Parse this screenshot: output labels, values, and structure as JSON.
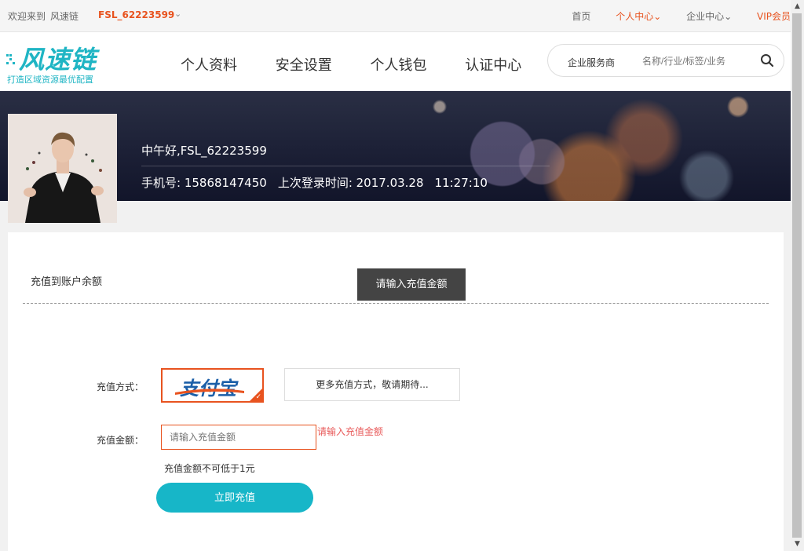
{
  "topbar": {
    "welcome": "欢迎来到",
    "site_name": "风速链",
    "username": "FSL_62223599",
    "links": [
      {
        "label": "首页"
      },
      {
        "label": "个人中心⌄"
      },
      {
        "label": "企业中心⌄"
      },
      {
        "label": "VIP会员"
      }
    ]
  },
  "logo": {
    "text": "风速链",
    "slogan": "打造区域资源最优配置"
  },
  "nav": [
    "个人资料",
    "安全设置",
    "个人钱包",
    "认证中心"
  ],
  "search": {
    "category": "企业服务商",
    "placeholder": "名称/行业/标签/业务"
  },
  "profile": {
    "greeting": "中午好,FSL_62223599",
    "phone": "手机号: 15868147450",
    "last_login": "上次登录时间: 2017.03.28",
    "last_login_time": "11:27:10"
  },
  "recharge": {
    "section_title": "充值到账户余额",
    "tooltip": "请输入充值金额",
    "method_label": "充值方式：",
    "alipay_text": "支付宝",
    "more_methods": "更多充值方式，敬请期待...",
    "amount_label": "充值金额：",
    "amount_placeholder": "请输入充值金额",
    "error": "请输入充值金额",
    "hint": "充值金额不可低于1元",
    "submit": "立即充值"
  },
  "colors": {
    "accent": "#17b6c8",
    "alert": "#e8531f",
    "alipay": "#1b5fa8"
  }
}
